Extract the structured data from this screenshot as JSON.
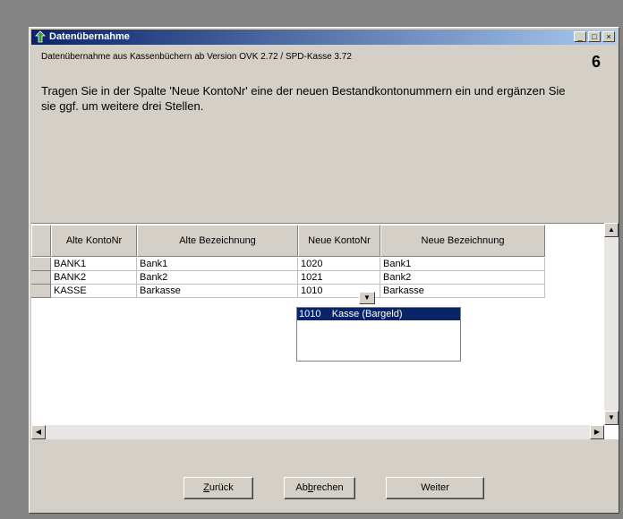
{
  "window": {
    "title": "Datenübernahme",
    "subtitle": "Datenübernahme aus Kassenbüchern ab Version OVK 2.72 / SPD-Kasse 3.72",
    "step": "6",
    "instruction": "Tragen Sie in der Spalte 'Neue KontoNr' eine der neuen Bestandkontonummern ein und ergänzen Sie sie ggf. um weitere drei Stellen.",
    "minimize_label": "_",
    "maximize_label": "□",
    "close_label": "×"
  },
  "table": {
    "columns": [
      "Alte KontoNr",
      "Alte Bezeichnung",
      "Neue KontoNr",
      "Neue Bezeichnung"
    ],
    "rows": [
      [
        "BANK1",
        "Bank1",
        "1020",
        "Bank1"
      ],
      [
        "BANK2",
        "Bank2",
        "1021",
        "Bank2"
      ],
      [
        "KASSE",
        "Barkasse",
        "1010",
        "Barkasse"
      ]
    ]
  },
  "dropdown": {
    "arrow": "▼",
    "selected_option": "1010    Kasse (Bargeld)"
  },
  "scrollbar": {
    "up": "▲",
    "down": "▼",
    "left": "◀",
    "right": "▶"
  },
  "buttons": {
    "back_pre": "",
    "back_ul": "Z",
    "back_post": "urück",
    "cancel_pre": "Ab",
    "cancel_ul": "b",
    "cancel_post": "rechen",
    "next": "Weiter"
  },
  "colors": {
    "titlebar_start": "#0a246a",
    "titlebar_end": "#a6caf0",
    "selection": "#0a246a",
    "face": "#d4d0c8"
  }
}
